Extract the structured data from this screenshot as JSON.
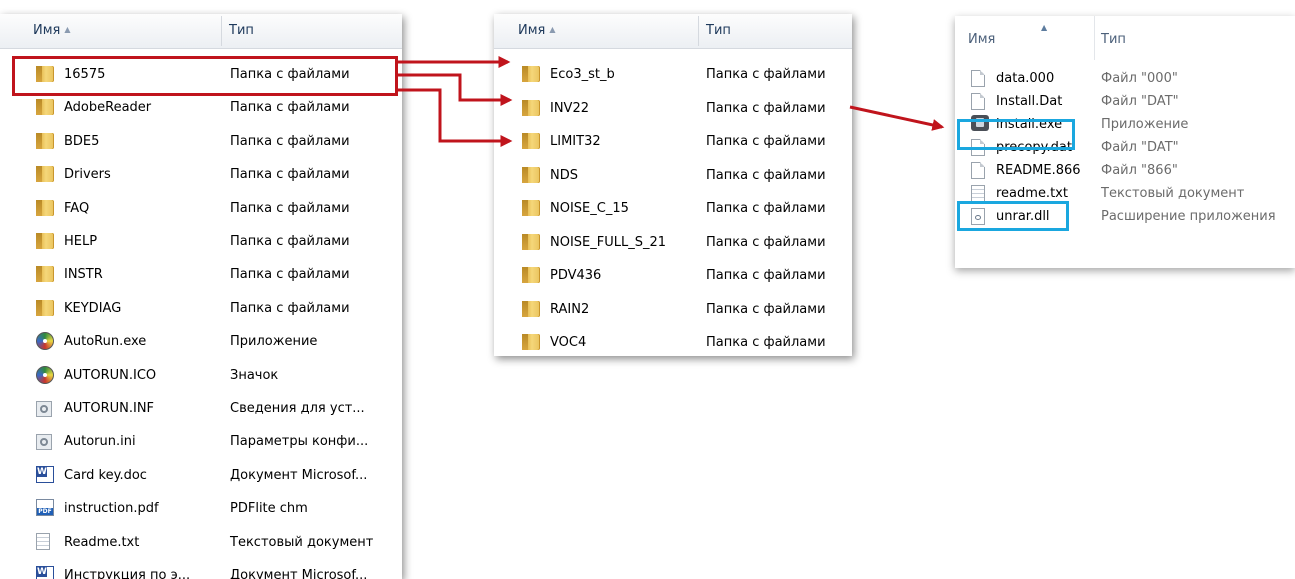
{
  "panel1": {
    "header": {
      "name": "Имя",
      "type": "Тип"
    },
    "rows": [
      {
        "icon": "folder-icon",
        "name": "16575",
        "type": "Папка с файлами"
      },
      {
        "icon": "folder-icon",
        "name": "AdobeReader",
        "type": "Папка с файлами"
      },
      {
        "icon": "folder-icon",
        "name": "BDE5",
        "type": "Папка с файлами"
      },
      {
        "icon": "folder-icon",
        "name": "Drivers",
        "type": "Папка с файлами"
      },
      {
        "icon": "folder-icon",
        "name": "FAQ",
        "type": "Папка с файлами"
      },
      {
        "icon": "folder-icon",
        "name": "HELP",
        "type": "Папка с файлами"
      },
      {
        "icon": "folder-icon",
        "name": "INSTR",
        "type": "Папка с файлами"
      },
      {
        "icon": "folder-icon",
        "name": "KEYDIAG",
        "type": "Папка с файлами"
      },
      {
        "icon": "autorun-disc-icon",
        "name": "AutoRun.exe",
        "type": "Приложение"
      },
      {
        "icon": "autorun-disc-icon",
        "name": "AUTORUN.ICO",
        "type": "Значок"
      },
      {
        "icon": "settings-file-icon",
        "name": "AUTORUN.INF",
        "type": "Сведения для уст..."
      },
      {
        "icon": "settings-file-icon",
        "name": "Autorun.ini",
        "type": "Параметры конфи..."
      },
      {
        "icon": "word-document-icon",
        "name": "Card key.doc",
        "type": "Документ Microsof..."
      },
      {
        "icon": "pdf-file-icon",
        "name": "instruction.pdf",
        "type": "PDFlite chm"
      },
      {
        "icon": "text-file-icon",
        "name": "Readme.txt",
        "type": "Текстовый документ"
      },
      {
        "icon": "word-document-icon",
        "name": "Инструкция по э...",
        "type": "Документ Microsof..."
      }
    ]
  },
  "panel2": {
    "header": {
      "name": "Имя",
      "type": "Тип"
    },
    "rows": [
      {
        "icon": "folder-icon",
        "name": "Eco3_st_b",
        "type": "Папка с файлами"
      },
      {
        "icon": "folder-icon",
        "name": "INV22",
        "type": "Папка с файлами"
      },
      {
        "icon": "folder-icon",
        "name": "LIMIT32",
        "type": "Папка с файлами"
      },
      {
        "icon": "folder-icon",
        "name": "NDS",
        "type": "Папка с файлами"
      },
      {
        "icon": "folder-icon",
        "name": "NOISE_C_15",
        "type": "Папка с файлами"
      },
      {
        "icon": "folder-icon",
        "name": "NOISE_FULL_S_21",
        "type": "Папка с файлами"
      },
      {
        "icon": "folder-icon",
        "name": "PDV436",
        "type": "Папка с файлами"
      },
      {
        "icon": "folder-icon",
        "name": "RAIN2",
        "type": "Папка с файлами"
      },
      {
        "icon": "folder-icon",
        "name": "VOC4",
        "type": "Папка с файлами"
      }
    ]
  },
  "panel3": {
    "header": {
      "name": "Имя",
      "type": "Тип"
    },
    "rows": [
      {
        "icon": "file-icon",
        "name": "data.000",
        "type": "Файл \"000\""
      },
      {
        "icon": "file-icon",
        "name": "Install.Dat",
        "type": "Файл \"DAT\""
      },
      {
        "icon": "installer-exe-icon",
        "name": "install.exe",
        "type": "Приложение"
      },
      {
        "icon": "file-icon",
        "name": "precopy.dat",
        "type": "Файл \"DAT\""
      },
      {
        "icon": "file-icon",
        "name": "README.866",
        "type": "Файл \"866\""
      },
      {
        "icon": "text-file-icon",
        "name": "readme.txt",
        "type": "Текстовый документ"
      },
      {
        "icon": "dll-file-icon",
        "name": "unrar.dll",
        "type": "Расширение приложения"
      }
    ]
  },
  "highlight_colors": {
    "arrow_red": "#c0141c",
    "box_blue": "#1aa7df"
  }
}
